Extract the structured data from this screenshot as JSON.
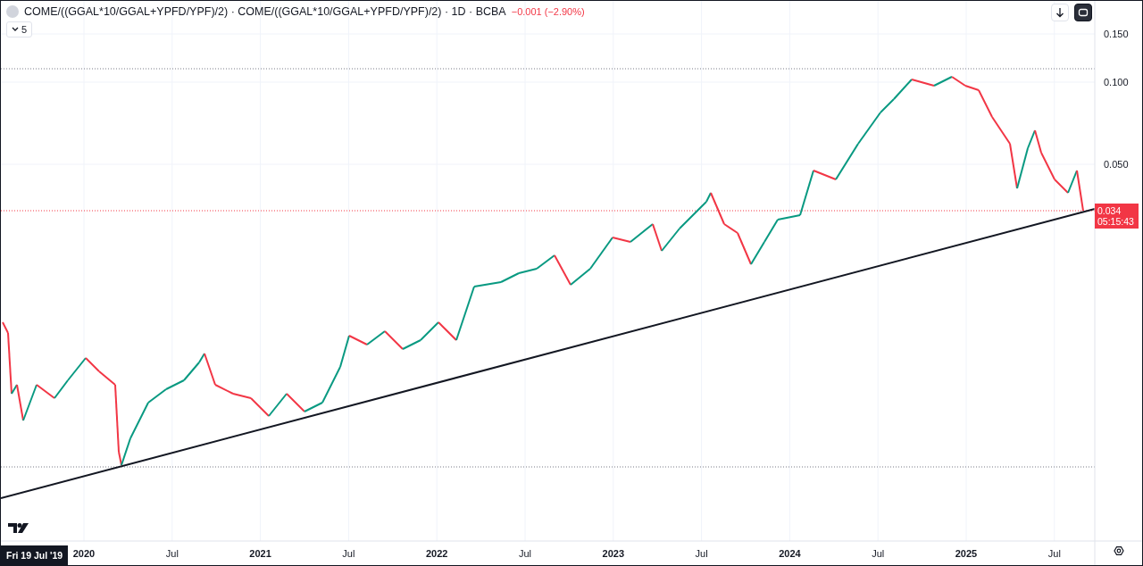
{
  "legend": {
    "title": "COME/((GGAL*10/GGAL+YPFD/YPF)/2) · COME/((GGAL*10/GGAL+YPFD/YPF)/2) · 1D · BCBA",
    "change": "−0.001 (−2.90%)",
    "indicators_count": "5"
  },
  "price_axis": {
    "labels": [
      "0.150",
      "0.100",
      "0.050"
    ]
  },
  "time_axis": {
    "labels": [
      {
        "label": "2020",
        "kind": "year"
      },
      {
        "label": "Jul",
        "kind": "month"
      },
      {
        "label": "2021",
        "kind": "year"
      },
      {
        "label": "Jul",
        "kind": "month"
      },
      {
        "label": "2022",
        "kind": "year"
      },
      {
        "label": "Jul",
        "kind": "month"
      },
      {
        "label": "2023",
        "kind": "year"
      },
      {
        "label": "Jul",
        "kind": "month"
      },
      {
        "label": "2024",
        "kind": "year"
      },
      {
        "label": "Jul",
        "kind": "month"
      },
      {
        "label": "2025",
        "kind": "year"
      },
      {
        "label": "Jul",
        "kind": "month"
      }
    ]
  },
  "last_price": {
    "value": "0.034",
    "countdown": "05:15:43"
  },
  "crosshair_date": "Fri 19 Jul '19"
}
